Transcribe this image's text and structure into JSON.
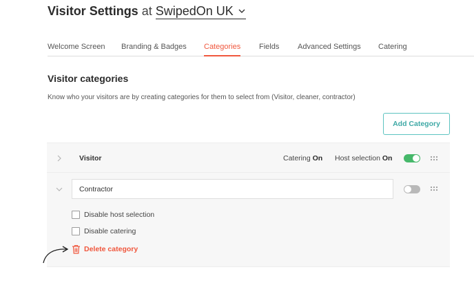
{
  "header": {
    "title": "Visitor Settings",
    "at": "at",
    "venue": "SwipedOn UK"
  },
  "tabs": [
    {
      "label": "Welcome Screen",
      "active": false
    },
    {
      "label": "Branding & Badges",
      "active": false
    },
    {
      "label": "Categories",
      "active": true
    },
    {
      "label": "Fields",
      "active": false
    },
    {
      "label": "Advanced Settings",
      "active": false
    },
    {
      "label": "Catering",
      "active": false
    }
  ],
  "section": {
    "title": "Visitor categories",
    "description": "Know who your visitors are by creating categories for them to select from (Visitor, cleaner, contractor)",
    "add_button": "Add Category"
  },
  "categories": [
    {
      "name": "Visitor",
      "expanded": false,
      "catering_label": "Catering",
      "catering_value": "On",
      "host_label": "Host selection",
      "host_value": "On",
      "enabled": true
    },
    {
      "name": "Contractor",
      "expanded": true,
      "enabled": false,
      "options": [
        {
          "label": "Disable host selection",
          "checked": false
        },
        {
          "label": "Disable catering",
          "checked": false
        }
      ],
      "delete_label": "Delete category"
    }
  ],
  "colors": {
    "accent": "#f0573d",
    "teal": "#5cc3c0",
    "toggle_on": "#46b86a",
    "toggle_off": "#b9b9b9"
  }
}
